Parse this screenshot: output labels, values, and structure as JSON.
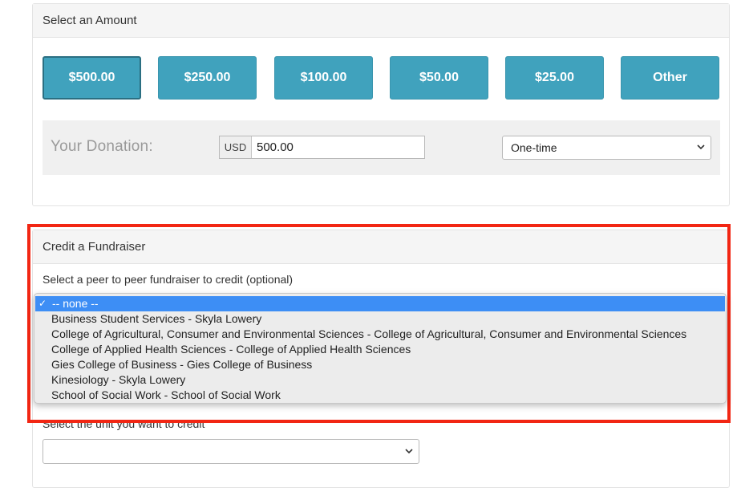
{
  "amount_panel": {
    "heading": "Select an Amount",
    "buttons": [
      "$500.00",
      "$250.00",
      "$100.00",
      "$50.00",
      "$25.00",
      "Other"
    ],
    "selected_button": "$500.00",
    "donation_label": "Your Donation:",
    "currency": "USD",
    "amount_value": "500.00",
    "frequency": "One-time"
  },
  "credit_panel": {
    "heading": "Credit a Fundraiser",
    "sublabel": "Select a peer to peer fundraiser to credit (optional)",
    "unit_label": "Select the unit you want to credit",
    "unit_value": ""
  },
  "dropdown": {
    "options": [
      "-- none --",
      "Business Student Services - Skyla Lowery",
      "College of Agricultural, Consumer and Environmental Sciences - College of Agricultural, Consumer and Environmental Sciences",
      "College of Applied Health Sciences - College of Applied Health Sciences",
      "Gies College of Business - Gies College of Business",
      "Kinesiology - Skyla Lowery",
      "School of Social Work - School of Social Work"
    ],
    "selected": "-- none --",
    "check_glyph": "✓"
  },
  "icons": {
    "dropdown_arrow": "chevron-down-icon",
    "checkmark": "check-icon"
  },
  "colors": {
    "button_bg": "#40a2bd",
    "selection_highlight": "#3d8ef5",
    "annotation_border": "#f22613"
  }
}
